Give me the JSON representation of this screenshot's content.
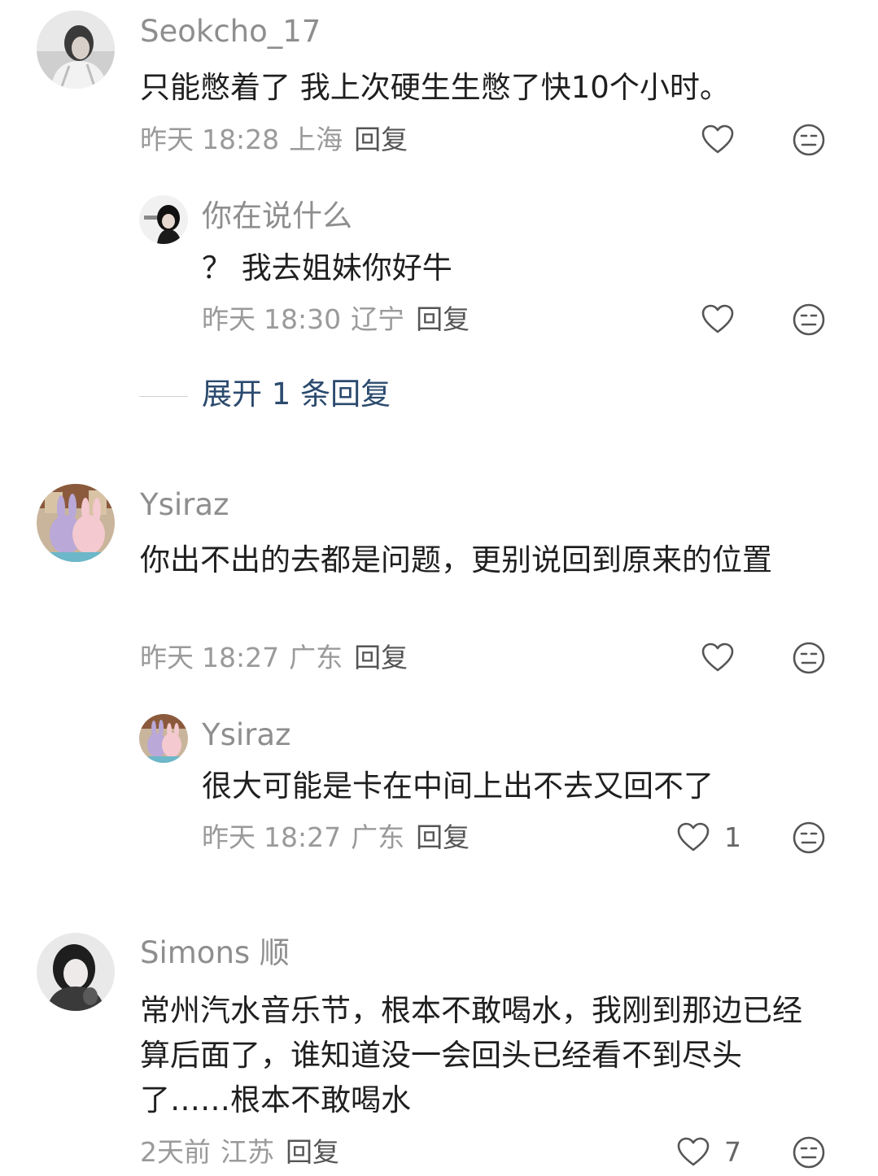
{
  "comments": [
    {
      "username": "Seokcho_17",
      "text": "只能憋着了 我上次硬生生憋了快10个小时。",
      "date": "昨天",
      "time": "18:28",
      "location": "上海",
      "reply_label": "回复",
      "likes": "",
      "replies": [
        {
          "username": "你在说什么",
          "text": "？ 我去姐妹你好牛",
          "date": "昨天",
          "time": "18:30",
          "location": "辽宁",
          "reply_label": "回复",
          "likes": ""
        }
      ],
      "expand_label": "展开 1 条回复"
    },
    {
      "username": "Ysiraz",
      "text": "你出不出的去都是问题，更别说回到原来的位置",
      "date": "昨天",
      "time": "18:27",
      "location": "广东",
      "reply_label": "回复",
      "likes": "",
      "replies": [
        {
          "username": "Ysiraz",
          "text": "很大可能是卡在中间上出不去又回不了",
          "date": "昨天",
          "time": "18:27",
          "location": "广东",
          "reply_label": "回复",
          "likes": "1"
        }
      ]
    },
    {
      "username": "Simons 顺",
      "text": "常州汽水音乐节，根本不敢喝水，我刚到那边已经算后面了，谁知道没一会回头已经看不到尽头了……根本不敢喝水",
      "date": "2天前",
      "time": "",
      "location": "江苏",
      "reply_label": "回复",
      "likes": "7",
      "replies": []
    }
  ],
  "icons": {
    "like": "heart-outline-icon",
    "dislike": "neutral-face-icon"
  },
  "colors": {
    "text": "#1f1f1f",
    "meta": "#9a9a9a",
    "username": "#8e8e8e",
    "expand": "#2b4a6e",
    "icon_stroke": "#555555"
  }
}
